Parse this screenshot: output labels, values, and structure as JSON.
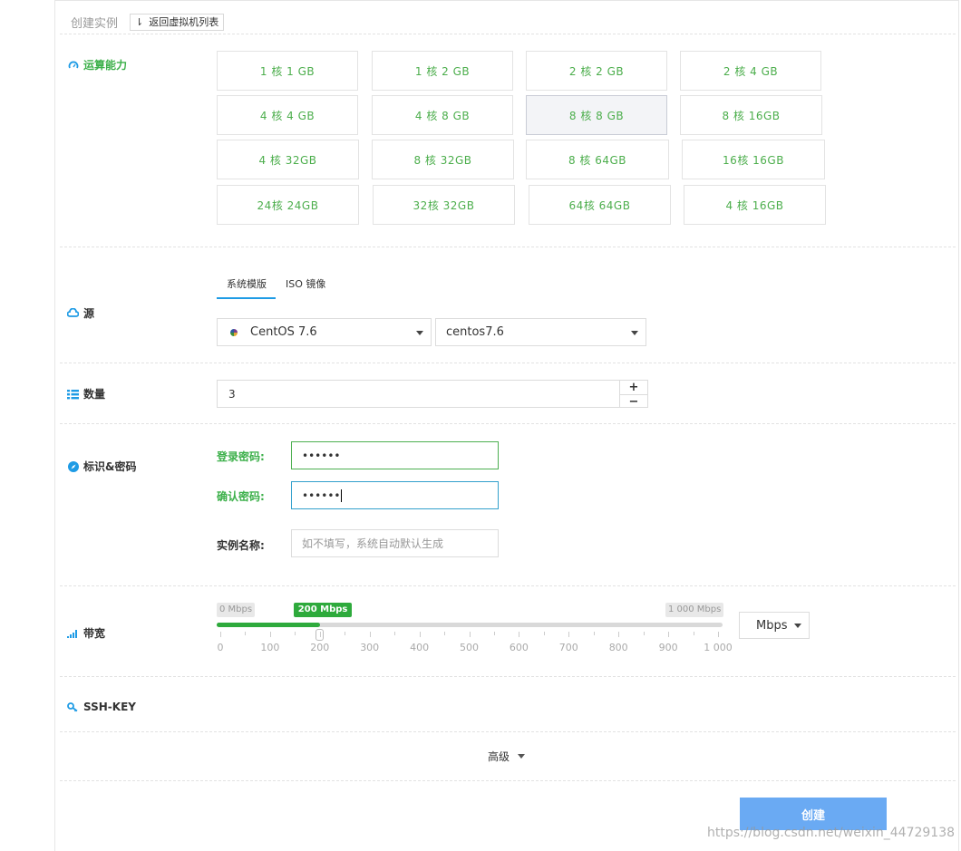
{
  "header": {
    "title": "创建实例",
    "back_label": "返回虚拟机列表"
  },
  "sections": {
    "compute": "运算能力",
    "source": "源",
    "quantity": "数量",
    "identity": "标识&密码",
    "bandwidth": "带宽",
    "ssh_key": "SSH-KEY"
  },
  "specs": [
    {
      "label": "1 核 1 GB"
    },
    {
      "label": "1 核 2 GB"
    },
    {
      "label": "2 核 2 GB"
    },
    {
      "label": "2 核 4 GB"
    },
    {
      "label": "4 核 4 GB"
    },
    {
      "label": "4 核 8 GB"
    },
    {
      "label": "8 核 8 GB",
      "selected": true
    },
    {
      "label": "8 核 16GB"
    },
    {
      "label": "4 核 32GB"
    },
    {
      "label": "8 核 32GB"
    },
    {
      "label": "8 核 64GB"
    },
    {
      "label": "16核 16GB"
    },
    {
      "label": "24核 24GB"
    },
    {
      "label": "32核 32GB"
    },
    {
      "label": "64核 64GB"
    },
    {
      "label": "4 核 16GB"
    }
  ],
  "source": {
    "tabs": [
      "系统模版",
      "ISO 镜像"
    ],
    "active_tab": "系统模版",
    "os": "CentOS 7.6",
    "image": "centos7.6"
  },
  "quantity": {
    "value": "3",
    "inc": "+",
    "dec": "−"
  },
  "identity": {
    "login_label": "登录密码:",
    "login_value": "••••••",
    "confirm_label": "确认密码:",
    "confirm_value": "••••••",
    "name_label": "实例名称:",
    "name_placeholder": "如不填写，系统自动默认生成"
  },
  "bandwidth": {
    "min_label": "0 Mbps",
    "max_label": "1 000 Mbps",
    "current_label": "200 Mbps",
    "value": 200,
    "max": 1000,
    "ticks": [
      "0",
      "100",
      "200",
      "300",
      "400",
      "500",
      "600",
      "700",
      "800",
      "900",
      "1 000"
    ],
    "unit": "Mbps"
  },
  "advanced_label": "高级",
  "create_label": "创建",
  "watermark": "https://blog.csdn.net/weixin_44729138",
  "colors": {
    "accent_green": "#2eaa3c",
    "spec_text": "#4cae4c",
    "icon_blue": "#1e9be5",
    "create_btn": "#6aaaf3"
  }
}
